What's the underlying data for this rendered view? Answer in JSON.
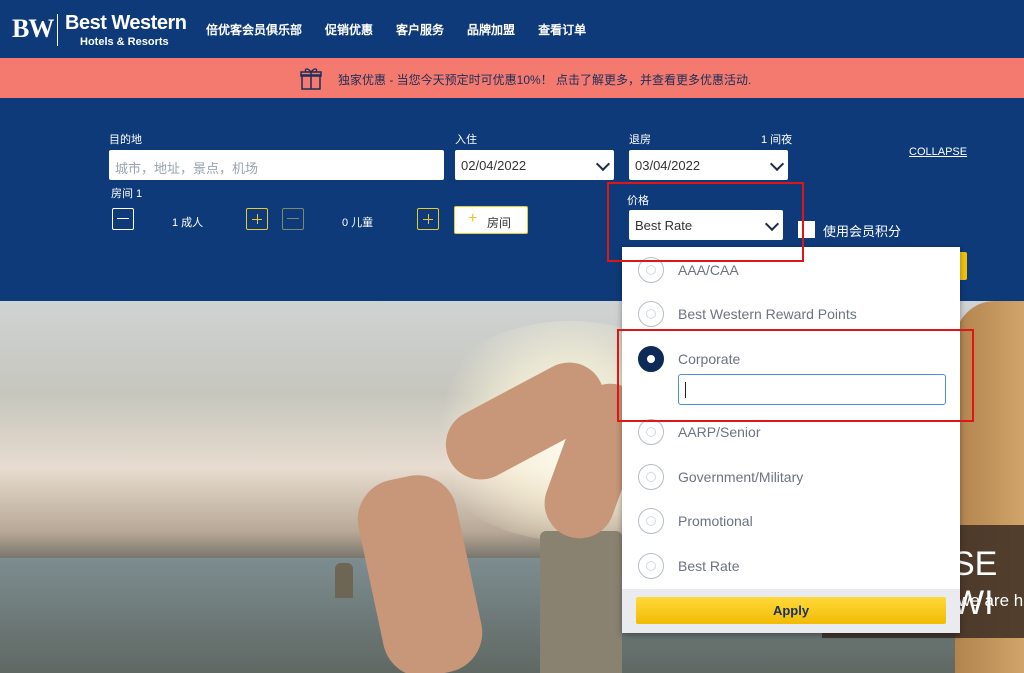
{
  "header": {
    "logo_mark": "BW",
    "logo_brand": "Best Western",
    "logo_sub": "Hotels & Resorts",
    "nav": [
      "倍优客会员俱乐部",
      "促销优惠",
      "客户服务",
      "品牌加盟",
      "查看订单"
    ]
  },
  "promo": {
    "text": "独家优惠 - 当您今天预定时可优惠10%！ 点击了解更多，并查看更多优惠活动.",
    "icon": "gift-icon"
  },
  "search": {
    "destination_label": "目的地",
    "destination_placeholder": "城市，地址，景点，机场",
    "checkin_label": "入住",
    "checkin_value": "02/04/2022",
    "checkout_label": "退房",
    "checkout_value": "03/04/2022",
    "nights": "1 间夜",
    "collapse": "COLLAPSE",
    "room_label": "房间 1",
    "adults": "1 成人",
    "children": "0 儿童",
    "add_room": "房间",
    "rate_label": "价格",
    "rate_value": "Best Rate",
    "points_label": "使用会员积分"
  },
  "rate_dropdown": {
    "options": [
      "AAA/CAA",
      "Best Western Reward Points",
      "Corporate",
      "AARP/Senior",
      "Government/Military",
      "Promotional",
      "Best Rate"
    ],
    "selected": "Corporate",
    "apply": "Apply"
  },
  "hero": {
    "headline": "SE WI",
    "subline": "we are h"
  },
  "colors": {
    "navy": "#0e3a7a",
    "promo": "#f47a6f",
    "accent": "#f2c30f",
    "highlight": "#e01515"
  }
}
